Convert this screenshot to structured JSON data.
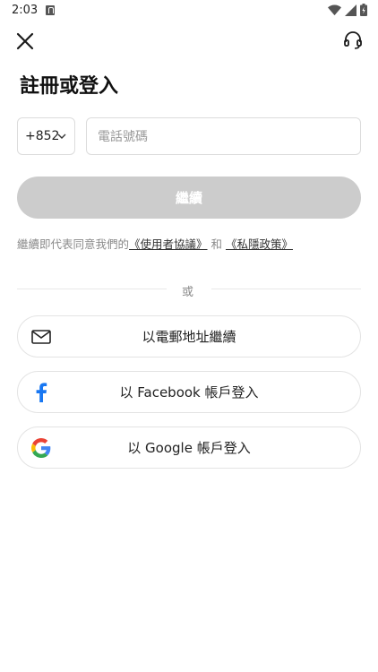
{
  "status_bar": {
    "time": "2:03"
  },
  "header": {
    "title": "註冊或登入"
  },
  "phone": {
    "country_code": "+852",
    "placeholder": "電話號碼"
  },
  "continue_label": "繼續",
  "terms": {
    "prefix": "繼續即代表同意我們的",
    "terms_link": "《使用者協議》",
    "joiner": " 和 ",
    "privacy_link": "《私隱政策》"
  },
  "divider_text": "或",
  "social": {
    "email_label": "以電郵地址繼續",
    "facebook_label": "以 Facebook 帳戶登入",
    "google_label": "以 Google 帳戶登入"
  },
  "colors": {
    "continue_disabled": "#cccccc",
    "facebook_blue": "#1877f2"
  }
}
